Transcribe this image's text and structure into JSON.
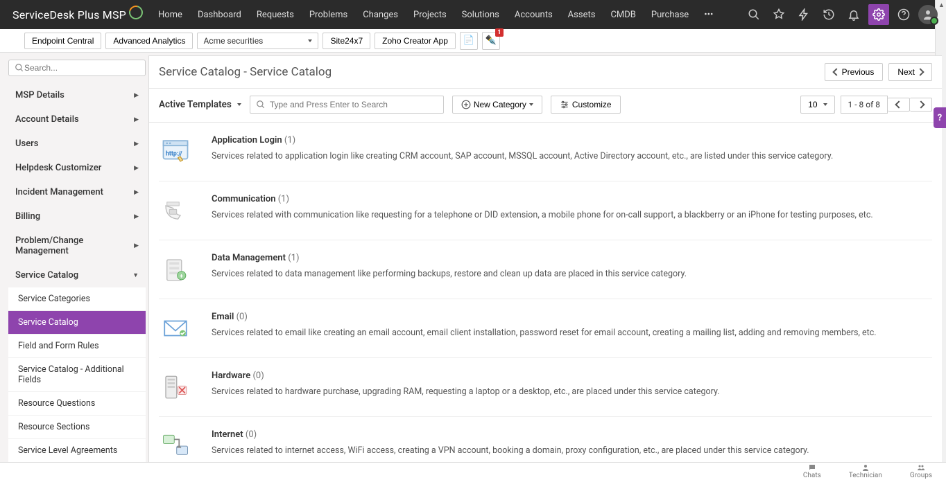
{
  "logo_text": "ServiceDesk Plus MSP",
  "topnav": [
    "Home",
    "Dashboard",
    "Requests",
    "Problems",
    "Changes",
    "Projects",
    "Solutions",
    "Accounts",
    "Assets",
    "CMDB",
    "Purchase"
  ],
  "second_bar": {
    "endpoint": "Endpoint Central",
    "analytics": "Advanced Analytics",
    "account_selected": "Acme securities",
    "site247": "Site24x7",
    "zoho": "Zoho Creator App",
    "badge": "1"
  },
  "sidebar": {
    "search_placeholder": "Search...",
    "groups": [
      "MSP Details",
      "Account Details",
      "Users",
      "Helpdesk Customizer",
      "Incident Management",
      "Billing",
      "Problem/Change Management",
      "Service Catalog"
    ],
    "subs": [
      "Service Categories",
      "Service Catalog",
      "Field and Form Rules",
      "Service Catalog - Additional Fields",
      "Resource Questions",
      "Resource Sections",
      "Service Level Agreements"
    ]
  },
  "page": {
    "title": "Service Catalog - Service Catalog",
    "prev": "Previous",
    "next": "Next"
  },
  "toolbar": {
    "active_label": "Active Templates",
    "search_placeholder": "Type and Press Enter to Search",
    "new_cat": "New Category",
    "customize": "Customize",
    "pagesize": "10",
    "range": "1 - 8 of 8"
  },
  "categories": [
    {
      "title": "Application Login",
      "count": "(1)",
      "desc": "Services related to application login like creating CRM account, SAP account, MSSQL account, Active Directory account, etc., are listed under this service category.",
      "icon": "app"
    },
    {
      "title": "Communication",
      "count": "(1)",
      "desc": "Services related with communication like requesting for a telephone or DID extension, a mobile phone for on-call support, a blackberry or an iPhone for testing purposes, etc.",
      "icon": "comm"
    },
    {
      "title": "Data Management",
      "count": "(1)",
      "desc": "Services related to data management like performing backups, restore and clean up data are placed in this service category.",
      "icon": "data"
    },
    {
      "title": "Email",
      "count": "(0)",
      "desc": "Services related to email like creating an email account, email client installation, password reset for email account, creating a mailing list, adding and removing members, etc.",
      "icon": "email"
    },
    {
      "title": "Hardware",
      "count": "(0)",
      "desc": "Services related to hardware purchase, upgrading RAM, requesting a laptop or a desktop, etc., are placed under this service category.",
      "icon": "hw"
    },
    {
      "title": "Internet",
      "count": "(0)",
      "desc": "Services related to internet access, WiFi access, creating a VPN account, booking a domain, proxy configuration, etc., are placed under this service category.",
      "icon": "net"
    }
  ],
  "footer": {
    "chats": "Chats",
    "tech": "Technician",
    "groups": "Groups"
  },
  "help": "?"
}
